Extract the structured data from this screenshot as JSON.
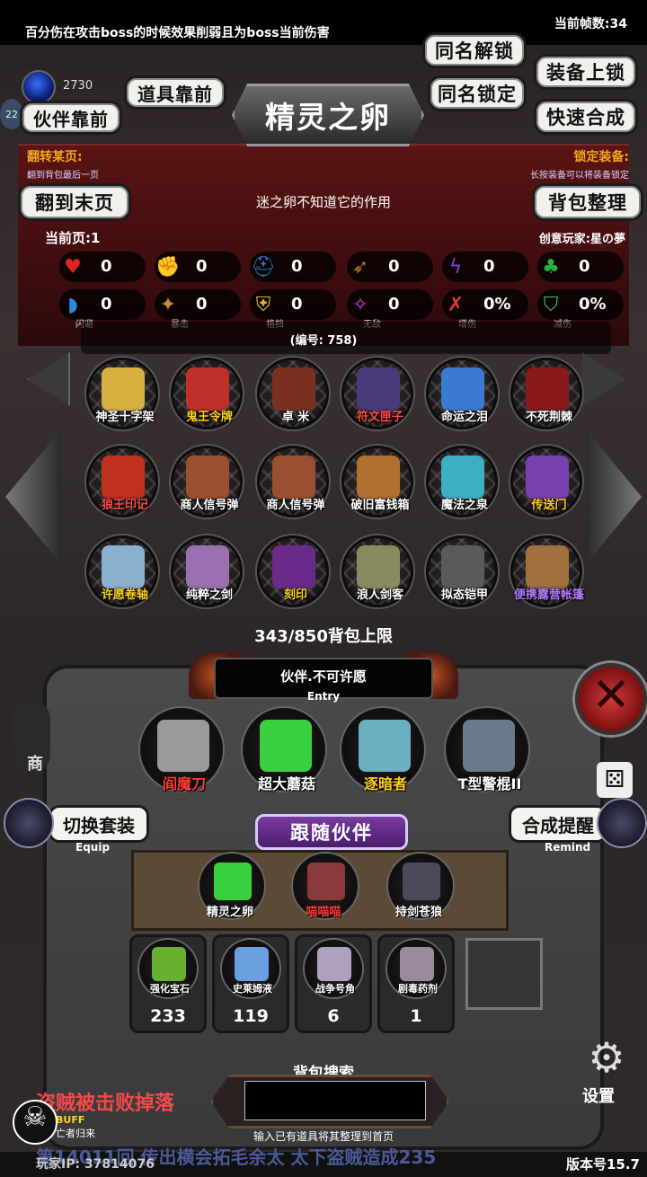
{
  "top_hint": "百分伤在攻击boss的时候效果削弱且为boss当前伤害",
  "fps_label": "当前帧数:34",
  "gem_count": "2730",
  "level_badge": "22",
  "buttons": {
    "same_name_unlock": "同名解锁",
    "equip_lock": "装备上锁",
    "same_name_lock": "同名锁定",
    "quick_combine": "快速合成",
    "items_front": "道具靠前",
    "partner_front": "伙伴靠前",
    "to_last_page": "翻到末页",
    "sort_bag": "背包整理",
    "switch_outfit": "切换套装",
    "switch_outfit_sub": "Equip",
    "combine_remind": "合成提醒",
    "combine_remind_sub": "Remind",
    "follow_partner": "跟随伙伴"
  },
  "title": "精灵之卵",
  "left_tip": {
    "label": "翻转某页:",
    "sub": "翻到背包最后一页"
  },
  "right_tip": {
    "label": "锁定装备:",
    "sub": "长按装备可以将装备锁定"
  },
  "description": "迷之卵不知道它的作用",
  "current_page": "当前页:1",
  "creator": "创意玩家:星の夢",
  "stats_row1": [
    {
      "icon": "heart-icon",
      "value": "0",
      "color": "#e02424"
    },
    {
      "icon": "fist-icon",
      "value": "0",
      "color": "#e8c020"
    },
    {
      "icon": "helmet-icon",
      "value": "0",
      "color": "#2a7acc"
    },
    {
      "icon": "bow-icon",
      "value": "0",
      "color": "#b08020"
    },
    {
      "icon": "lightning-icon",
      "value": "0",
      "color": "#8a3ad0"
    },
    {
      "icon": "clover-icon",
      "value": "0",
      "color": "#2ab040"
    }
  ],
  "stats_row2": [
    {
      "icon": "dodge-icon",
      "value": "0",
      "label": "闪避",
      "color": "#2a8ae0"
    },
    {
      "icon": "crit-icon",
      "value": "0",
      "label": "暴击",
      "color": "#c09030"
    },
    {
      "icon": "block-icon",
      "value": "0",
      "label": "格挡",
      "color": "#e0c020"
    },
    {
      "icon": "invincible-icon",
      "value": "0",
      "label": "无敌",
      "color": "#d040d0"
    },
    {
      "icon": "damage-up-icon",
      "value": "0%",
      "label": "增伤",
      "color": "#e03a3a"
    },
    {
      "icon": "damage-down-icon",
      "value": "0%",
      "label": "减伤",
      "color": "#3ac05a"
    }
  ],
  "serial": "(编号:  758)",
  "items": [
    {
      "name": "神圣十字架",
      "color": "#ffffff",
      "art": "#d8b040"
    },
    {
      "name": "鬼王令牌",
      "color": "#ffd21e",
      "art": "#c0302a"
    },
    {
      "name": "卓 米",
      "color": "#ffffff",
      "art": "#7a3020"
    },
    {
      "name": "符文匣子",
      "color": "#ff4a4a",
      "art": "#4a3a7a"
    },
    {
      "name": "命运之泪",
      "color": "#ffffff",
      "art": "#3a7ad0"
    },
    {
      "name": "不死荆棘",
      "color": "#ffffff",
      "art": "#8a1a1a"
    },
    {
      "name": "狼王印记",
      "color": "#ff4a4a",
      "art": "#c03020"
    },
    {
      "name": "商人信号弹",
      "color": "#ffffff",
      "art": "#9a5030"
    },
    {
      "name": "商人信号弹",
      "color": "#ffffff",
      "art": "#9a5030"
    },
    {
      "name": "破旧富钱箱",
      "color": "#ffffff",
      "art": "#b07030"
    },
    {
      "name": "魔法之泉",
      "color": "#ffffff",
      "art": "#3ab0c0"
    },
    {
      "name": "传送门",
      "color": "#ffd21e",
      "art": "#7a40b0"
    },
    {
      "name": "许愿卷轴",
      "color": "#ffd21e",
      "art": "#8ab0d0"
    },
    {
      "name": "纯粹之剑",
      "color": "#ffffff",
      "art": "#9a70b0"
    },
    {
      "name": "刻印",
      "color": "#ffd21e",
      "art": "#6a2a8a"
    },
    {
      "name": "浪人剑客",
      "color": "#ffffff",
      "art": "#8a8a60"
    },
    {
      "name": "拟态铠甲",
      "color": "#ffffff",
      "art": "#5a5a5a"
    },
    {
      "name": "便携露营帐篷",
      "color": "#b07aff",
      "art": "#a07040"
    }
  ],
  "capacity": "343/850背包上限",
  "entry": {
    "title": "伙伴.不可许愿",
    "sub": "Entry"
  },
  "equipped": [
    {
      "name": "阎魔刀",
      "color": "#ff3a3a",
      "art": "#9a9a9a"
    },
    {
      "name": "超大蘑菇",
      "color": "#ffffff",
      "art": "#3ad040"
    },
    {
      "name": "逐暗者",
      "color": "#ffd21e",
      "art": "#6ab0c0"
    },
    {
      "name": "T型警棍II",
      "color": "#ffffff",
      "art": "#6a7a8a"
    }
  ],
  "followers": [
    {
      "name": "精灵之卵",
      "color": "#ffffff",
      "art": "#3ad040"
    },
    {
      "name": "喵喵喵",
      "color": "#ff3a3a",
      "art": "#8a3a3a"
    },
    {
      "name": "持剑苍狼",
      "color": "#ffffff",
      "art": "#4a4a5a"
    }
  ],
  "materials": [
    {
      "name": "强化宝石",
      "count": "233",
      "art": "#6ab030"
    },
    {
      "name": "史莱姆液",
      "count": "119",
      "art": "#6aa0e0"
    },
    {
      "name": "战争号角",
      "count": "6",
      "art": "#b0a0c0"
    },
    {
      "name": "剧毒药剂",
      "count": "1",
      "art": "#9a8aa0"
    }
  ],
  "search": {
    "label": "背包搜索",
    "placeholder": "",
    "hint": "输入已有道具将其整理到首页"
  },
  "ticker1": "盗贼被击败掉落",
  "ticker2": "第14011回 传出横会拓毛余太   太下盗贼造成235",
  "buff": {
    "label": "BUFF",
    "desc": "亡者归来"
  },
  "settings_label": "设置",
  "shop_label": "商",
  "player_ip": "玩家IP:   37814076",
  "version": "版本号15.7"
}
